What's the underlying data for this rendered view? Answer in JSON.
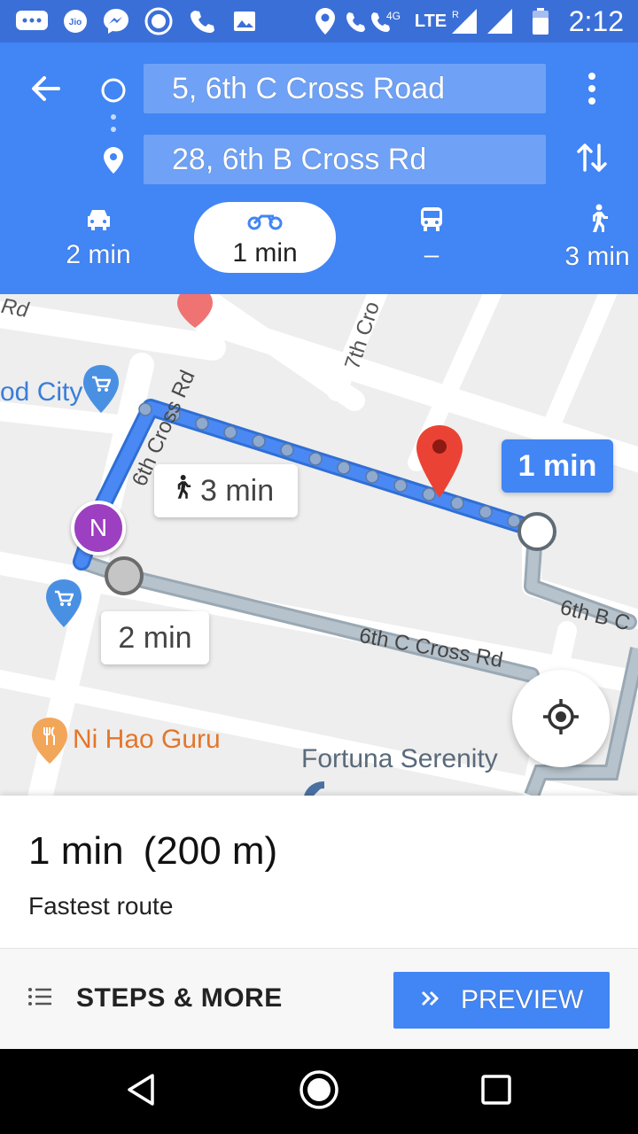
{
  "status_bar": {
    "time": "2:12",
    "network_label": "LTE",
    "network_gen": "4G",
    "roaming": "R",
    "icons": [
      "message-icon",
      "jio-icon",
      "messenger-icon",
      "hotspot-icon",
      "phone-icon",
      "gallery-icon",
      "location-icon",
      "volte-call-icon",
      "signal-icon",
      "signal-icon",
      "battery-icon"
    ]
  },
  "directions": {
    "origin": "5, 6th C Cross Road",
    "destination": "28, 6th B Cross Rd",
    "modes": [
      {
        "name": "car",
        "time": "2 min",
        "selected": false
      },
      {
        "name": "motorbike",
        "time": "1 min",
        "selected": true
      },
      {
        "name": "transit",
        "time": "–",
        "selected": false
      },
      {
        "name": "walk",
        "time": "3 min",
        "selected": false
      }
    ]
  },
  "map": {
    "route_label": "1 min",
    "walk_label": "3 min",
    "alt_label": "2 min",
    "marker_letter": "N",
    "places": {
      "food_city": "od City",
      "ni_hao": "Ni Hao Guru",
      "fortuna": "Fortuna Serenity"
    },
    "roads": {
      "rd_top_left": "Rd",
      "seventh_cross": "7th Cro",
      "sixth_cross": "6th Cross Rd",
      "sixth_c_cross": "6th C Cross Rd",
      "sixth_b": "6th B C"
    },
    "colors": {
      "route": "#4a89f3",
      "alt_route": "#b7c3cc",
      "destination": "#ea4335"
    }
  },
  "summary": {
    "title": "1 min (200 m)",
    "subtitle": "Fastest route"
  },
  "actions": {
    "steps_label": "STEPS & MORE",
    "preview_label": "PREVIEW"
  }
}
